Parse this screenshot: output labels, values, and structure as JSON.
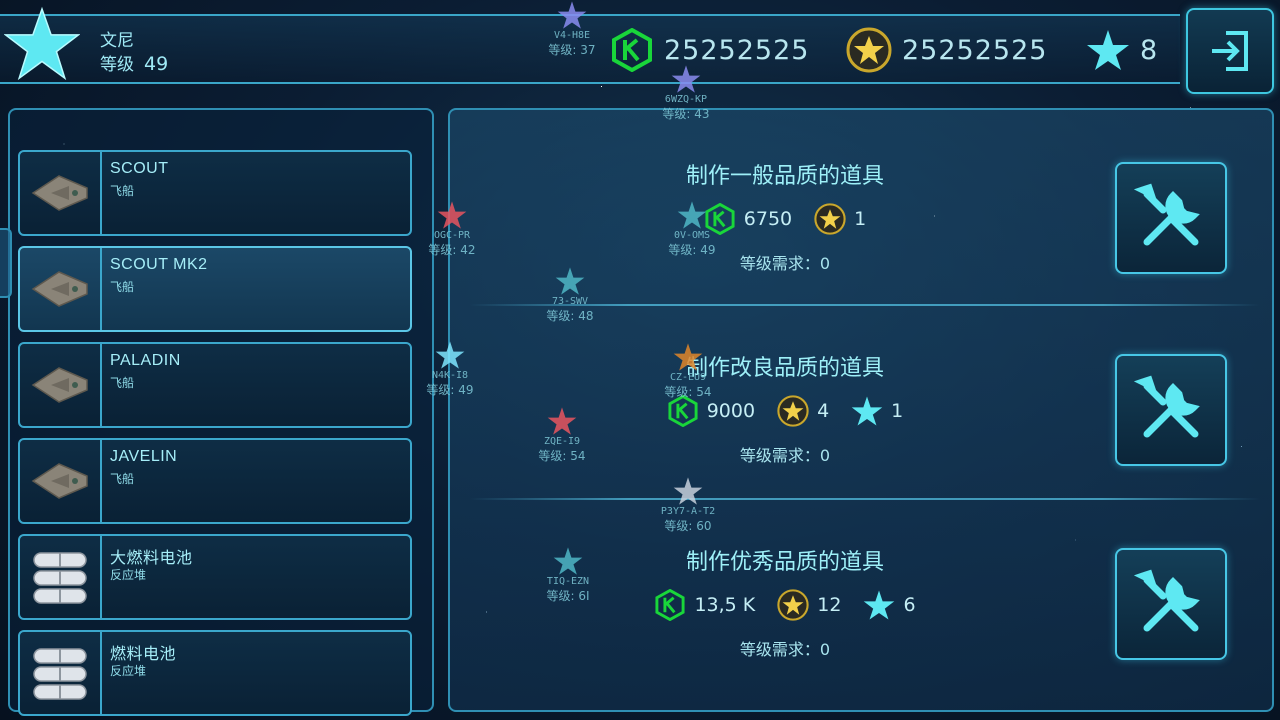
{
  "player": {
    "name": "文尼",
    "level_label": "等级",
    "level": "49"
  },
  "resources": {
    "credits": {
      "icon": "credit-hex-icon",
      "value": "25252525"
    },
    "coins": {
      "icon": "gold-star-coin-icon",
      "value": "25252525"
    },
    "xp": {
      "icon": "cyan-star-icon",
      "value": "8"
    }
  },
  "exit_button": {
    "icon": "exit-icon"
  },
  "items": [
    {
      "name": "SCOUT",
      "type": "飞船",
      "icon": "ship-icon"
    },
    {
      "name": "SCOUT MK2",
      "type": "飞船",
      "icon": "ship-icon",
      "selected": true
    },
    {
      "name": "PALADIN",
      "type": "飞船",
      "icon": "ship-icon"
    },
    {
      "name": "JAVELIN",
      "type": "飞船",
      "icon": "ship-icon"
    },
    {
      "name": "大燃料电池",
      "type": "反应堆",
      "icon": "fuel-cell-icon"
    },
    {
      "name": "燃料电池",
      "type": "反应堆",
      "icon": "fuel-cell-icon"
    }
  ],
  "crafting": [
    {
      "title": "制作一般品质的道具",
      "credits": "6750",
      "coins": "1",
      "stars": null,
      "req_label": "等级需求：",
      "req_value": "0"
    },
    {
      "title": "制作改良品质的道具",
      "credits": "9000",
      "coins": "4",
      "stars": "1",
      "req_label": "等级需求：",
      "req_value": "0"
    },
    {
      "title": "制作优秀品质的道具",
      "credits": "13,5 K",
      "coins": "12",
      "stars": "6",
      "req_label": "等级需求：",
      "req_value": "0"
    }
  ],
  "map_markers": [
    {
      "code": "V4-H8E",
      "level": "等级: 37",
      "color": "#8a8cf0"
    },
    {
      "code": "6WZQ-KP",
      "level": "等级: 43",
      "color": "#8a8cf0"
    },
    {
      "code": "OGC-PR",
      "level": "等级: 42",
      "color": "#e85560"
    },
    {
      "code": "0V-OMS",
      "level": "等级: 49",
      "color": "#4fb7c6"
    },
    {
      "code": "73-SWV",
      "level": "等级: 48",
      "color": "#4fb7c6"
    },
    {
      "code": "N4K-I8",
      "level": "等级: 49",
      "color": "#7fe6ff"
    },
    {
      "code": "CZ-EU9",
      "level": "等级: 54",
      "color": "#e0862a"
    },
    {
      "code": "ZQE-I9",
      "level": "等级: 54",
      "color": "#e85560"
    },
    {
      "code": "P3Y7-A-T2",
      "level": "等级: 60",
      "color": "#c6d0dc"
    },
    {
      "code": "TIQ-EZN",
      "level": "等级: 6I",
      "color": "#4fb7c6"
    }
  ],
  "colors": {
    "accent": "#3ec7e0",
    "credit_green": "#19d63a",
    "coin_gold": "#e6c23a",
    "star_cyan": "#5ee8f2"
  }
}
